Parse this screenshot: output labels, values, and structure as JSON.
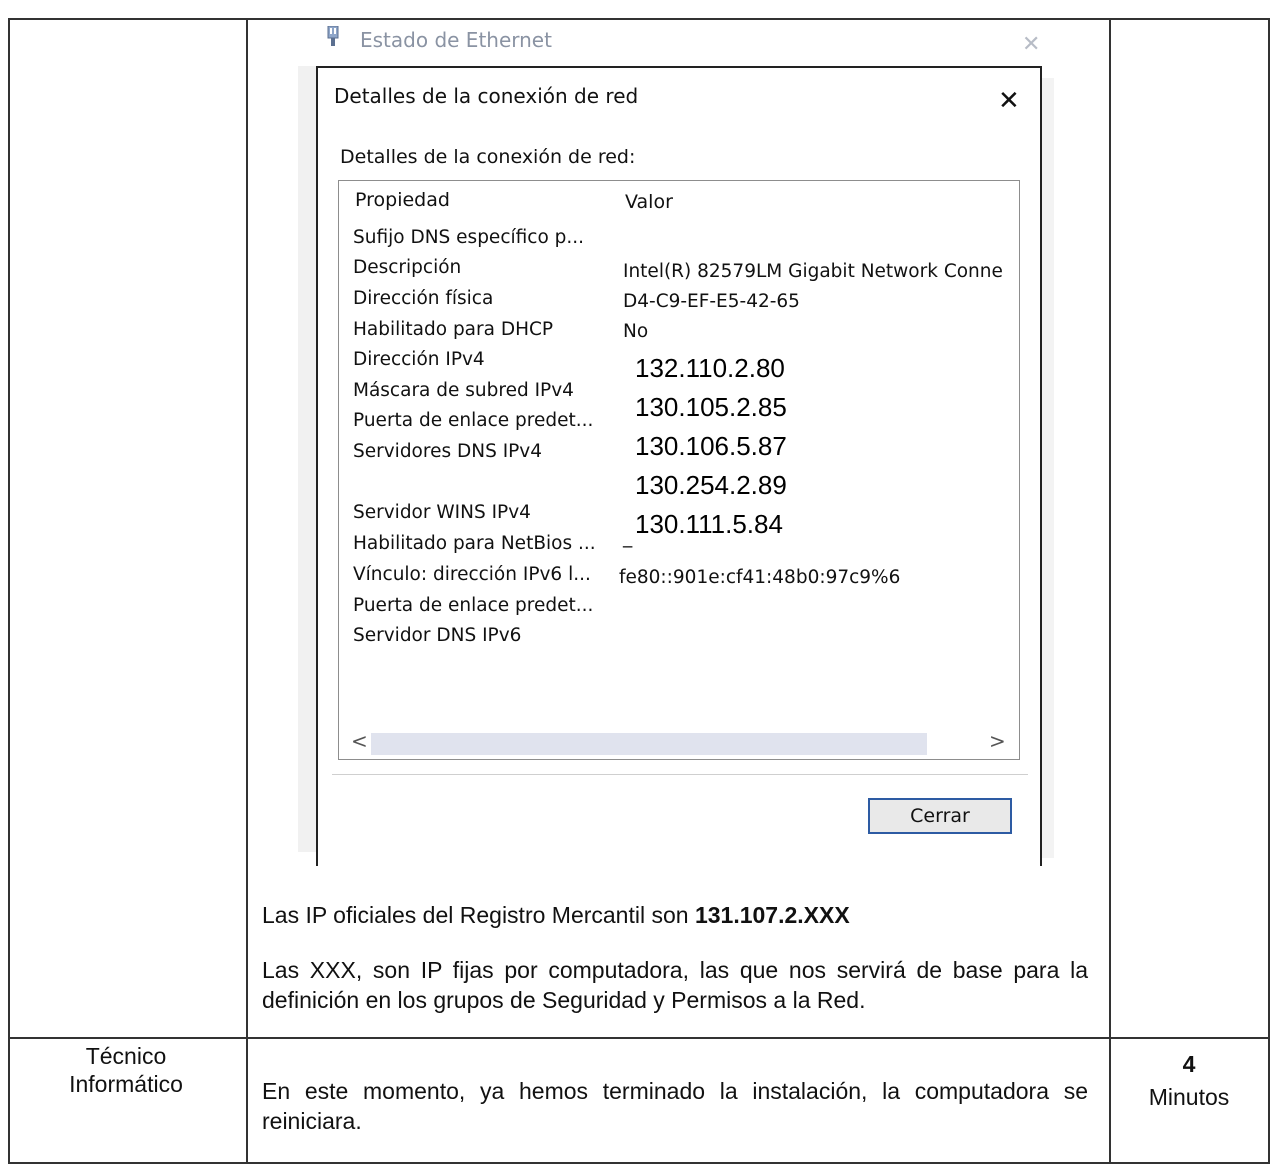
{
  "background_window": {
    "title": "Estado de Ethernet",
    "icon": "network-adapter-icon",
    "close_symbol": "✕"
  },
  "dialog": {
    "title": "Detalles de la conexión de red",
    "close_symbol": "✕",
    "section_label": "Detalles de la conexión de red:",
    "columns": {
      "property": "Propiedad",
      "value": "Valor"
    },
    "rows": [
      {
        "property": "Sufijo DNS específico p...",
        "value": ""
      },
      {
        "property": "Descripción",
        "value": "Intel(R) 82579LM Gigabit Network Conne"
      },
      {
        "property": "Dirección física",
        "value": "D4-C9-EF-E5-42-65"
      },
      {
        "property": "Habilitado para DHCP",
        "value": "No"
      },
      {
        "property": "Dirección IPv4",
        "value": ""
      },
      {
        "property": "Máscara de subred IPv4",
        "value": ""
      },
      {
        "property": "Puerta de enlace predet...",
        "value": ""
      },
      {
        "property": "Servidores DNS IPv4",
        "value": ""
      },
      {
        "property": "Servidor WINS IPv4",
        "value": ""
      },
      {
        "property": "Habilitado para NetBios ...",
        "value": "_"
      },
      {
        "property": "Vínculo: dirección IPv6 l...",
        "value": "fe80::901e:cf41:48b0:97c9%6"
      },
      {
        "property": "Puerta de enlace predet...",
        "value": ""
      },
      {
        "property": "Servidor DNS IPv6",
        "value": ""
      }
    ],
    "ip_overlay": [
      "132.110.2.80",
      "130.105.2.85",
      "130.106.5.87",
      "130.254.2.89",
      "130.111.5.84"
    ],
    "scroll_left": "<",
    "scroll_right": ">",
    "close_button": "Cerrar"
  },
  "text": {
    "ip_line_prefix": "Las IP oficiales del Registro Mercantil son ",
    "ip_line_bold": "131.107.2.XXX",
    "xxx_paragraph": "Las XXX, son IP fijas por computadora, las que nos servirá de base para la definición en los grupos de Seguridad y Permisos a la Red."
  },
  "row2": {
    "role": "Técnico Informático",
    "description": "En este momento, ya hemos terminado la instalación, la computadora se reiniciara.",
    "time_number": "4",
    "time_unit": "Minutos"
  }
}
